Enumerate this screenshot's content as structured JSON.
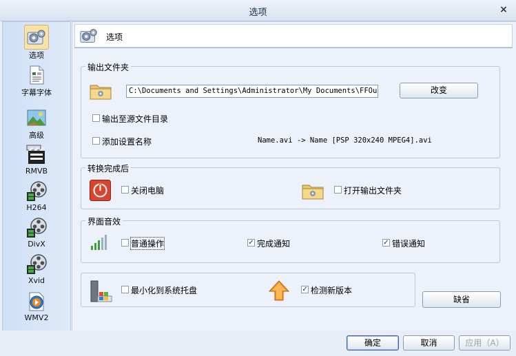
{
  "window": {
    "title": "选项",
    "close_glyph": "×"
  },
  "sidebar": {
    "items": [
      {
        "label": "选项",
        "icon": "gear-icon",
        "active": true
      },
      {
        "label": "字幕字体",
        "icon": "document-icon"
      },
      {
        "label": "高级",
        "icon": "landscape-picture-icon"
      },
      {
        "label": "RMVB",
        "icon": "clapperboard-icon"
      },
      {
        "label": "H264",
        "icon": "film-reel-icon"
      },
      {
        "label": "DivX",
        "icon": "film-reel-icon"
      },
      {
        "label": "Xvid",
        "icon": "film-reel-icon"
      },
      {
        "label": "WMV2",
        "icon": "media-player-icon"
      }
    ]
  },
  "header": {
    "title": "选项"
  },
  "output_folder": {
    "legend": "输出文件夹",
    "path": "C:\\Documents and Settings\\Administrator\\My Documents\\FFOutpu",
    "change_button": "改变",
    "output_to_source_label": "输出至源文件目录",
    "output_to_source_checked": false,
    "add_setting_name_label": "添加设置名称",
    "add_setting_name_checked": false,
    "example_text": "Name.avi  -> Name [PSP 320x240 MPEG4].avi"
  },
  "after_conversion": {
    "legend": "转换完成后",
    "shutdown_label": "关闭电脑",
    "shutdown_checked": false,
    "open_folder_label": "打开输出文件夹",
    "open_folder_checked": false
  },
  "sound": {
    "legend": "界面音效",
    "normal_label": "普通操作",
    "normal_checked": false,
    "complete_label": "完成通知",
    "complete_checked": true,
    "error_label": "错误通知",
    "error_checked": true
  },
  "misc": {
    "minimize_tray_label": "最小化到系统托盘",
    "minimize_tray_checked": false,
    "check_update_label": "检测新版本",
    "check_update_checked": true,
    "default_button": "缺省"
  },
  "footer": {
    "ok": "确定",
    "cancel": "取消",
    "apply": "应用（A）"
  }
}
